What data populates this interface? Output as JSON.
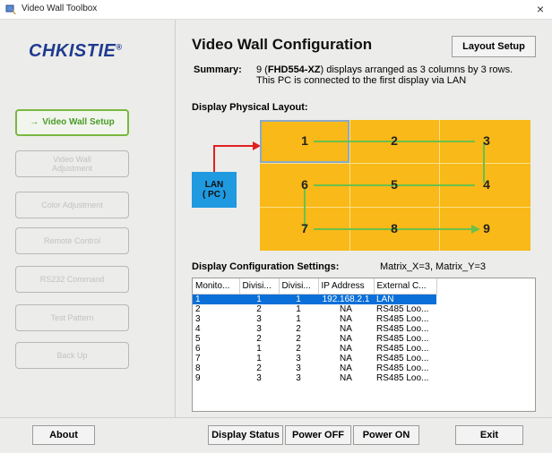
{
  "window": {
    "title": "Video Wall Toolbox",
    "close_glyph": "×"
  },
  "brand": {
    "logo_text": "CHKISTIE®"
  },
  "sidebar": {
    "items": [
      {
        "label": "Video Wall Setup",
        "state": "active",
        "icon": "arrow-right-icon",
        "icon_glyph": "→"
      },
      {
        "label": "Video Wall Adjustment",
        "state": "disabled"
      },
      {
        "label": "Color Adjustment",
        "state": "disabled"
      },
      {
        "label": "Remote Control",
        "state": "disabled"
      },
      {
        "label": "RS232 Command",
        "state": "disabled"
      },
      {
        "label": "Test Pattern",
        "state": "disabled"
      },
      {
        "label": "Back Up",
        "state": "disabled"
      }
    ]
  },
  "main": {
    "title": "Video Wall Configuration",
    "layout_setup_label": "Layout Setup",
    "summary": {
      "label": "Summary:",
      "line1_prefix": "9 (",
      "model": "FHD554-XZ",
      "line1_suffix": ") displays arranged as 3 columns by 3 rows.",
      "line2": "This PC is connected to the first display via LAN"
    },
    "physical_layout_label": "Display Physical Layout:",
    "lan_box": {
      "line1": "LAN",
      "line2": "( PC )"
    },
    "display_numbers": [
      "1",
      "2",
      "3",
      "4",
      "5",
      "6",
      "7",
      "8",
      "9"
    ],
    "config_label": "Display Configuration Settings:",
    "matrix_label": "Matrix_X=3, Matrix_Y=3"
  },
  "table": {
    "columns": [
      "Monito...",
      "Divisi...",
      "Divisi...",
      "IP Address",
      "External C..."
    ],
    "rows": [
      [
        "1",
        "1",
        "1",
        "192.168.2.1",
        "LAN"
      ],
      [
        "2",
        "2",
        "1",
        "NA",
        "RS485 Loo..."
      ],
      [
        "3",
        "3",
        "1",
        "NA",
        "RS485 Loo..."
      ],
      [
        "4",
        "3",
        "2",
        "NA",
        "RS485 Loo..."
      ],
      [
        "5",
        "2",
        "2",
        "NA",
        "RS485 Loo..."
      ],
      [
        "6",
        "1",
        "2",
        "NA",
        "RS485 Loo..."
      ],
      [
        "7",
        "1",
        "3",
        "NA",
        "RS485 Loo..."
      ],
      [
        "8",
        "2",
        "3",
        "NA",
        "RS485 Loo..."
      ],
      [
        "9",
        "3",
        "3",
        "NA",
        "RS485 Loo..."
      ]
    ],
    "selected_row": 0
  },
  "footer": {
    "about": "About",
    "display_status": "Display Status",
    "power_off": "Power OFF",
    "power_on": "Power ON",
    "exit": "Exit"
  },
  "colors": {
    "grid_fill": "#f9b918",
    "path_green": "#6cc04a",
    "lan_arrow": "#e02020",
    "lan_box": "#1f9ae0",
    "active_nav": "#79b83f",
    "brand_blue": "#1f3b8f",
    "selection_blue": "#0a6fd8"
  }
}
